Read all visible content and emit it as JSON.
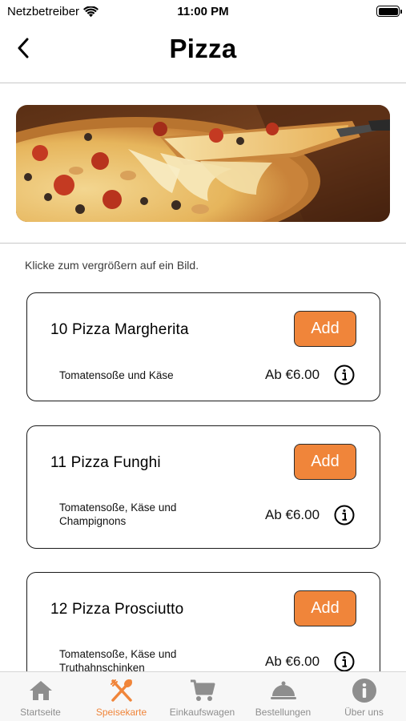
{
  "status_bar": {
    "carrier": "Netzbetreiber",
    "time": "11:00 PM"
  },
  "nav": {
    "title": "Pizza"
  },
  "hint": "Klicke zum vergrößern auf ein Bild.",
  "products": [
    {
      "title": "10 Pizza Margherita",
      "add_label": "Add",
      "description": "Tomatensoße und Käse",
      "price": "Ab €6.00"
    },
    {
      "title": "11 Pizza Funghi",
      "add_label": "Add",
      "description": "Tomatensoße, Käse und Champignons",
      "price": "Ab €6.00"
    },
    {
      "title": "12 Pizza Prosciutto",
      "add_label": "Add",
      "description": "Tomatensoße, Käse und Truthahnschinken",
      "price": "Ab €6.00"
    }
  ],
  "tabs": [
    {
      "label": "Startseite",
      "icon": "home-icon"
    },
    {
      "label": "Speisekarte",
      "icon": "fork-knife-icon",
      "active": true
    },
    {
      "label": "Einkaufswagen",
      "icon": "cart-icon"
    },
    {
      "label": "Bestellungen",
      "icon": "cloche-icon"
    },
    {
      "label": "Über uns",
      "icon": "info-circle-icon"
    }
  ],
  "colors": {
    "accent": "#f0853a",
    "tab_inactive": "#8e8e8e"
  }
}
